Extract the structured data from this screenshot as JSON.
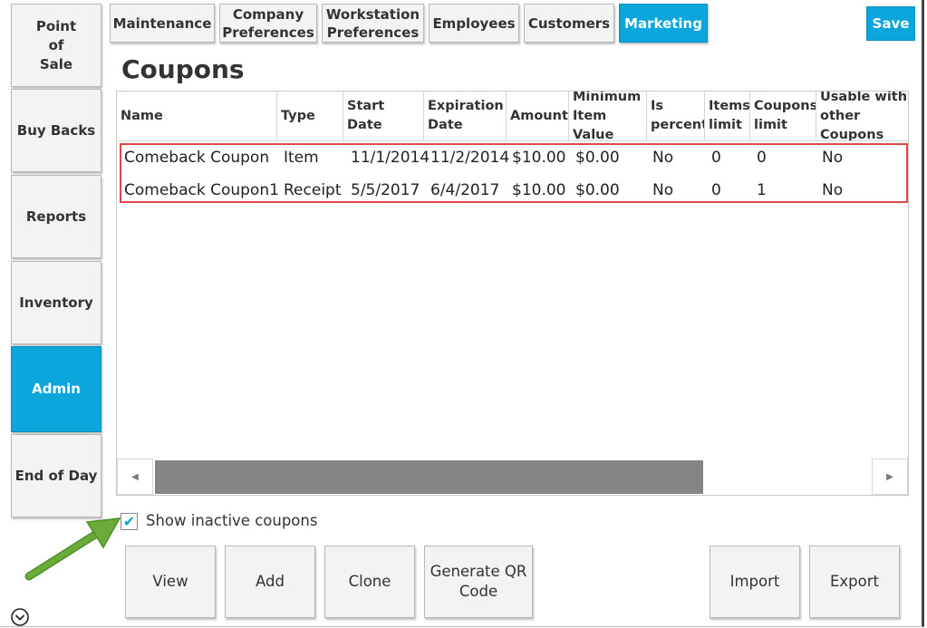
{
  "sidebar": {
    "items": [
      {
        "label": "Point\nof\nSale",
        "active": false
      },
      {
        "label": "Buy Backs",
        "active": false
      },
      {
        "label": "Reports",
        "active": false
      },
      {
        "label": "Inventory",
        "active": false
      },
      {
        "label": "Admin",
        "active": true
      },
      {
        "label": "End of Day",
        "active": false
      }
    ]
  },
  "tabs": [
    {
      "label": "Maintenance",
      "active": false
    },
    {
      "label": "Company\nPreferences",
      "active": false
    },
    {
      "label": "Workstation\nPreferences",
      "active": false
    },
    {
      "label": "Employees",
      "active": false
    },
    {
      "label": "Customers",
      "active": false
    },
    {
      "label": "Marketing",
      "active": true
    }
  ],
  "save_label": "Save",
  "page_title": "Coupons",
  "table": {
    "columns": [
      "Name",
      "Type",
      "Start\nDate",
      "Expiration\nDate",
      "Amount",
      "Minimum\nItem Value",
      "Is\npercent",
      "Items\nlimit",
      "Coupons\nlimit",
      "Usable with\nother Coupons"
    ],
    "rows": [
      [
        "Comeback Coupon",
        "Item",
        "11/1/2014",
        "11/2/2014",
        "$10.00",
        "$0.00",
        "No",
        "0",
        "0",
        "No"
      ],
      [
        "Comeback Coupon1",
        "Receipt",
        "5/5/2017",
        "6/4/2017",
        "$10.00",
        "$0.00",
        "No",
        "0",
        "1",
        "No"
      ]
    ]
  },
  "show_inactive": {
    "label": "Show inactive coupons",
    "checked": true
  },
  "actions": [
    "View",
    "Add",
    "Clone",
    "Generate QR\nCode",
    "Import",
    "Export"
  ],
  "colors": {
    "accent": "#0aa6dc",
    "highlight_border": "#e04848",
    "arrow": "#6aab3a"
  },
  "icons": {
    "collapse": "chevron-down-circle-icon",
    "scroll_left": "arrow-left-icon",
    "scroll_right": "arrow-right-icon"
  }
}
